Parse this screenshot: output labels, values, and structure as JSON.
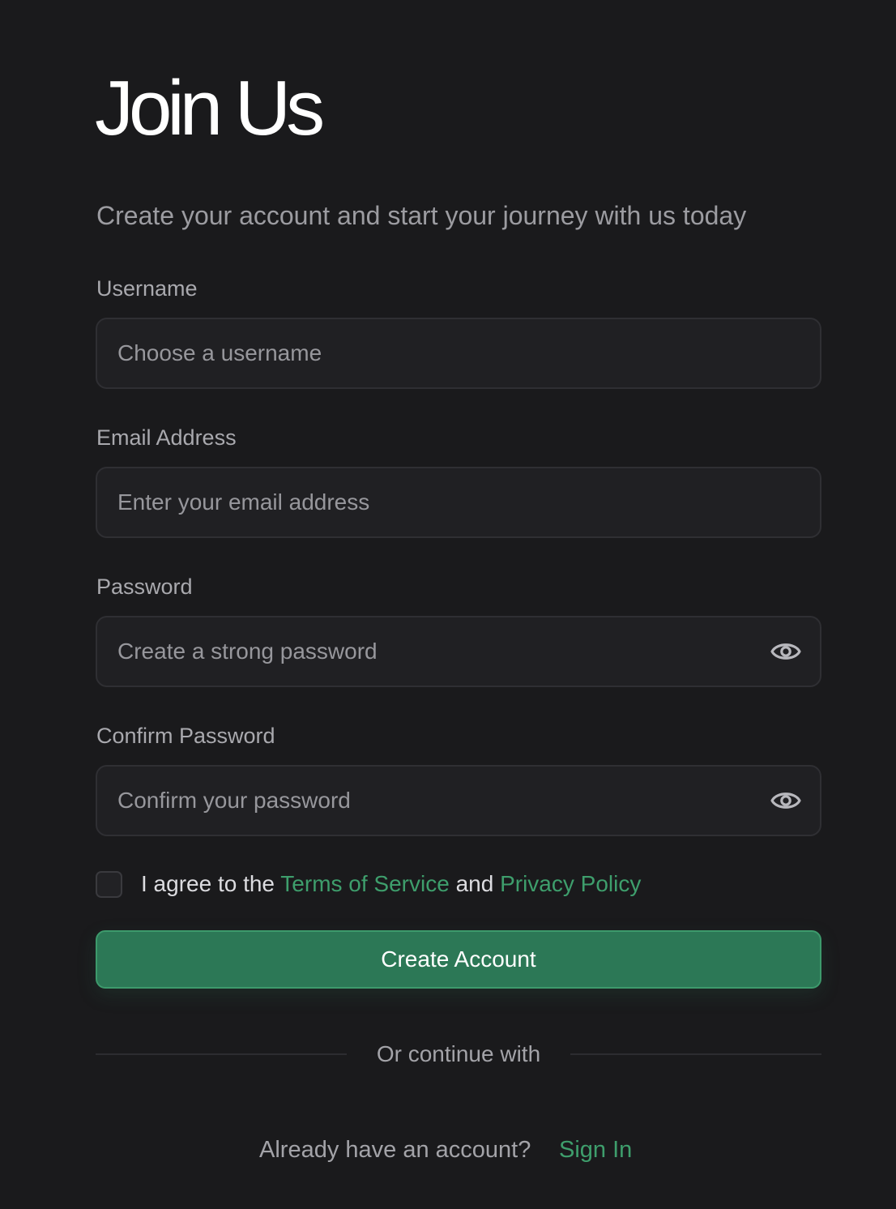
{
  "header": {
    "title": "Join Us",
    "subtitle": "Create your account and start your journey with us today"
  },
  "form": {
    "username": {
      "label": "Username",
      "placeholder": "Choose a username",
      "value": ""
    },
    "email": {
      "label": "Email Address",
      "placeholder": "Enter your email address",
      "value": ""
    },
    "password": {
      "label": "Password",
      "placeholder": "Create a strong password",
      "value": "",
      "toggle_icon": "eye-icon"
    },
    "confirm_password": {
      "label": "Confirm Password",
      "placeholder": "Confirm your password",
      "value": "",
      "toggle_icon": "eye-icon"
    },
    "terms": {
      "checked": false,
      "prefix": "I agree to the",
      "terms_link": "Terms of Service",
      "conjunction": "and",
      "privacy_link": "Privacy Policy"
    },
    "submit_label": "Create Account"
  },
  "divider": {
    "label": "Or continue with"
  },
  "footer": {
    "prompt": "Already have an account?",
    "signin_label": "Sign In"
  },
  "colors": {
    "background": "#1a1a1c",
    "accent": "#2c7856",
    "link": "#3e9e6c",
    "field_bg": "#202023",
    "field_border": "#2f2f33"
  }
}
